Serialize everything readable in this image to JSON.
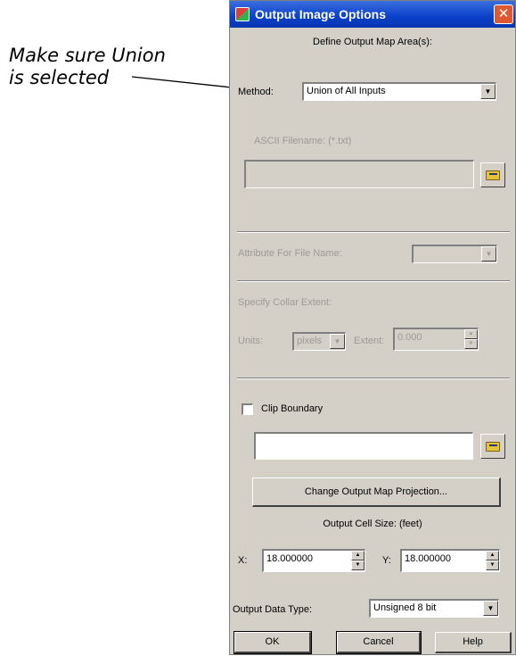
{
  "annotation": {
    "line1": "Make sure Union",
    "line2": "is selected"
  },
  "window": {
    "title": "Output Image Options",
    "close_glyph": "✕"
  },
  "define": {
    "heading": "Define Output Map Area(s):",
    "method_label": "Method:",
    "method_value": "Union of All Inputs"
  },
  "ascii": {
    "label": "ASCII Filename: (*.txt)",
    "value": ""
  },
  "attribute": {
    "label": "Attribute For File Name:",
    "value": ""
  },
  "collar": {
    "heading": "Specify Collar Extent:",
    "units_label": "Units:",
    "units_value": "pixels",
    "extent_label": "Extent:",
    "extent_value": "0.000"
  },
  "clip": {
    "label": "Clip Boundary",
    "checked": false,
    "value": ""
  },
  "projection": {
    "button_label": "Change Output Map Projection..."
  },
  "cell_size": {
    "heading": "Output Cell Size: (feet)",
    "x_label": "X:",
    "x_value": "18.000000",
    "y_label": "Y:",
    "y_value": "18.000000"
  },
  "data_type": {
    "label": "Output Data Type:",
    "value": "Unsigned 8 bit"
  },
  "buttons": {
    "ok": "OK",
    "cancel": "Cancel",
    "help": "Help"
  },
  "icons": {
    "app": "app-icon",
    "close": "close-icon",
    "folder": "folder-open-icon",
    "dropdown": "chevron-down-icon",
    "spin": "spinner-arrows-icon"
  }
}
